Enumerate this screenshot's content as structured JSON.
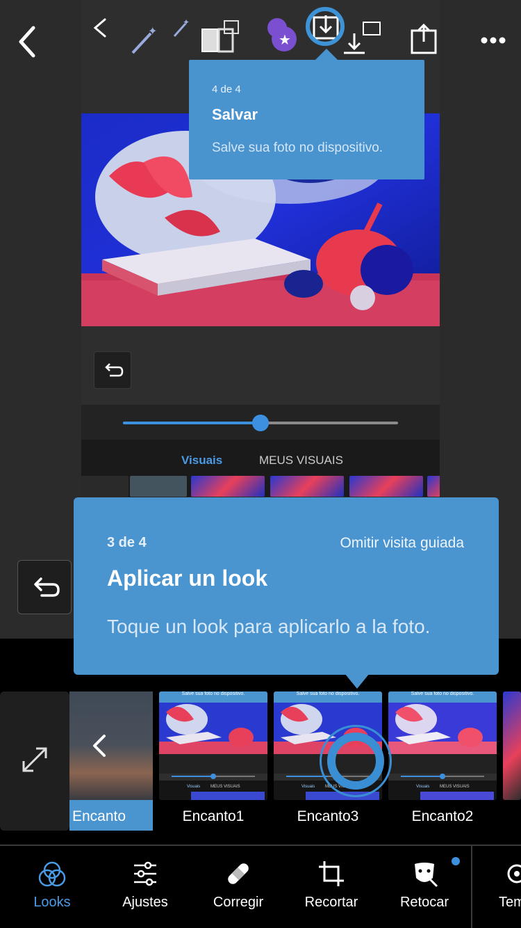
{
  "inner_screenshot": {
    "tabs": {
      "active": "Visuais",
      "inactive": "MEUS VISUAIS"
    },
    "slider": {
      "value_fraction": 0.5
    }
  },
  "coach_step4": {
    "step": "4 de 4",
    "title": "Salvar",
    "body": "Salve sua foto no dispositivo."
  },
  "coach_step3": {
    "step": "3 de 4",
    "skip": "Omitir visita guiada",
    "title": "Aplicar un look",
    "body": "Toque un look para aplicarlo a la foto."
  },
  "looks": {
    "selected": "Encanto",
    "items": [
      "Encanto1",
      "Encanto3",
      "Encanto2"
    ],
    "thumb_caption": "Salve sua foto no dispositivo.",
    "thumb_tab_active": "Visuais",
    "thumb_tab_inactive": "MEUS VISUAIS"
  },
  "bottom_nav": {
    "items": [
      {
        "label": "Looks",
        "icon": "looks-icon",
        "active": true
      },
      {
        "label": "Ajustes",
        "icon": "adjust-sliders-icon"
      },
      {
        "label": "Corregir",
        "icon": "bandage-icon"
      },
      {
        "label": "Recortar",
        "icon": "crop-icon"
      },
      {
        "label": "Retocar",
        "icon": "retouch-face-icon"
      },
      {
        "label": "Tem",
        "icon": "gear-icon"
      }
    ]
  },
  "colors": {
    "accent": "#3d8fe0",
    "coach_bg": "#4a94d0",
    "notification_dot": "#3d8fe0"
  }
}
